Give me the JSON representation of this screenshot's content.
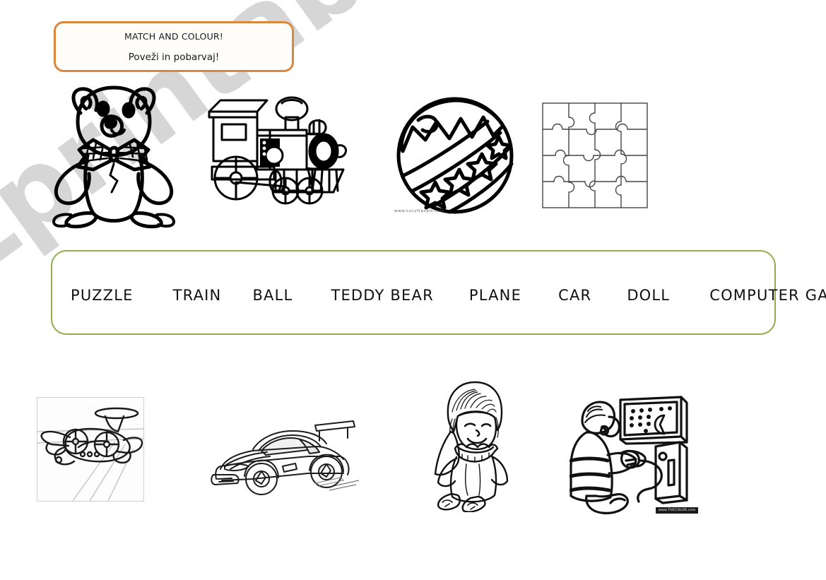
{
  "header": {
    "line_1": "MATCH AND COLOUR!",
    "line_2": "Poveži in pobarvaj!",
    "border_color": "#d9883f"
  },
  "word_bank": {
    "border_color": "#8fae4c",
    "words": [
      "PUZZLE",
      "TRAIN",
      "BALL",
      "TEDDY BEAR",
      "PLANE",
      "CAR",
      "DOLL",
      "COMPUTER GAME"
    ]
  },
  "pictures_top": [
    {
      "name": "teddy-bear",
      "label": "teddy bear line drawing"
    },
    {
      "name": "train",
      "label": "toy steam train line drawing"
    },
    {
      "name": "ball",
      "label": "striped star ball line drawing"
    },
    {
      "name": "puzzle",
      "label": "four by four jigsaw puzzle grid"
    }
  ],
  "pictures_bottom": [
    {
      "name": "plane",
      "label": "toy plane line drawing"
    },
    {
      "name": "car",
      "label": "sports car pencil sketch"
    },
    {
      "name": "doll",
      "label": "rag doll line drawing"
    },
    {
      "name": "computer-game",
      "label": "boy playing computer game"
    }
  ],
  "credits": {
    "ball_source": "www.Lucyfravels.com",
    "game_source": "www.THECOLOR.com"
  },
  "watermark": {
    "text": "ESLprintables.com",
    "color": "#c9c9c9"
  }
}
